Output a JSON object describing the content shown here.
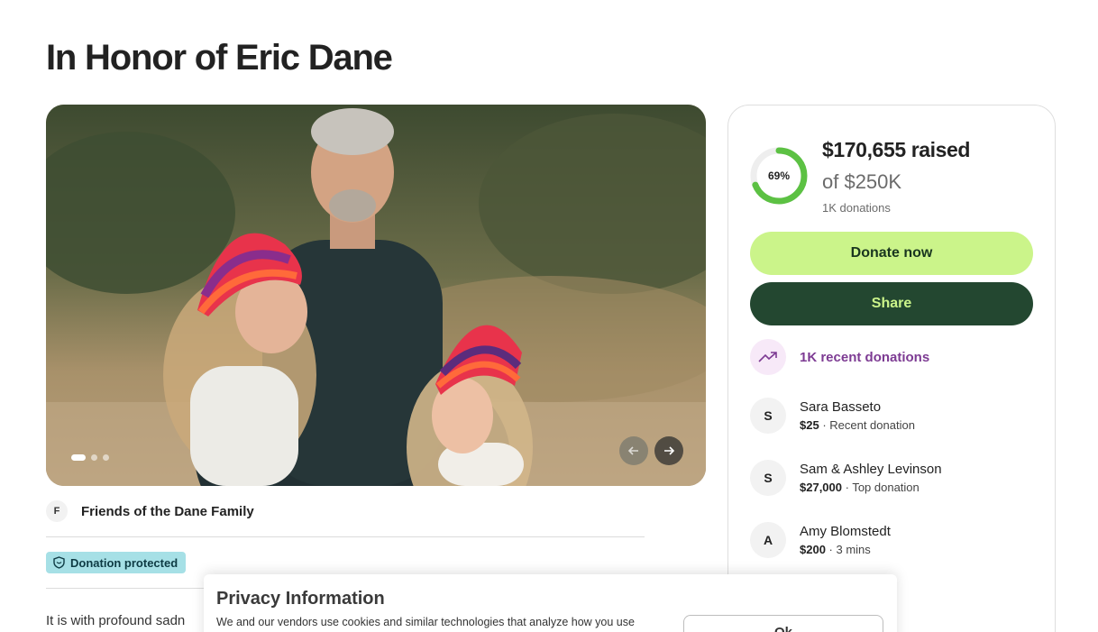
{
  "page": {
    "title": "In Honor of Eric Dane"
  },
  "gallery": {
    "prev_icon": "arrow-left-icon",
    "next_icon": "arrow-right-icon",
    "slide_count": 3,
    "active_slide": 1
  },
  "organizer": {
    "avatar_initial": "F",
    "name": "Friends of the Dane Family"
  },
  "badge": {
    "label": "Donation protected",
    "icon": "shield-icon"
  },
  "story": {
    "text": "It is with profound sadn"
  },
  "progress": {
    "percent_label": "69%",
    "fraction": 0.69
  },
  "fundraiser": {
    "raised": "$170,655 raised",
    "goal": "of $250K",
    "donation_count": "1K donations"
  },
  "actions": {
    "donate_label": "Donate now",
    "share_label": "Share"
  },
  "recent": {
    "label": "1K recent donations",
    "icon": "trending-up-icon"
  },
  "donors": [
    {
      "initial": "S",
      "name": "Sara Basseto",
      "amount": "$25",
      "detail": " · Recent donation"
    },
    {
      "initial": "S",
      "name": "Sam & Ashley Levinson",
      "amount": "$27,000",
      "detail": " · Top donation"
    },
    {
      "initial": "A",
      "name": "Amy Blomstedt",
      "amount": "$200",
      "detail": " · 3 mins"
    }
  ],
  "privacy": {
    "title": "Privacy Information",
    "text": "We and our vendors use cookies and similar technologies that analyze how you use",
    "button_label": "Ok"
  },
  "colors": {
    "donate_bg": "#cbf48a",
    "share_bg": "#234730",
    "progress_ring": "#5cc143",
    "recent_accent": "#7d3b93",
    "badge_bg": "#a6e0e6"
  }
}
